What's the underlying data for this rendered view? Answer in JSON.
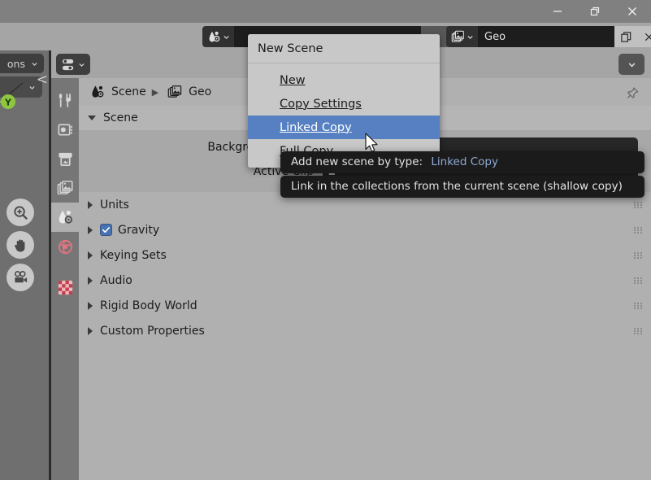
{
  "window": {
    "buttons": [
      {
        "name": "minimize",
        "glyph": "minimize-icon"
      },
      {
        "name": "restore",
        "glyph": "restore-icon"
      },
      {
        "name": "close",
        "glyph": "close-icon"
      }
    ]
  },
  "topbar": {
    "scene_datablock": {
      "icon": "scene-icon",
      "value": "",
      "browse_label": "Browse Scene"
    },
    "viewlayer_datablock": {
      "icon": "view-layer-icon",
      "value": "Geo",
      "copy_label": "New View Layer",
      "remove_label": "Remove View Layer"
    }
  },
  "viewport": {
    "overlay_dropdown_label": "ons",
    "gizmo_axis_label": "Y",
    "nav_buttons": [
      "zoom-region-icon",
      "pan-view-icon",
      "camera-view-icon"
    ],
    "collapse_label": "<"
  },
  "properties": {
    "editor_type": "properties-editor-icon",
    "header_dropdown": "chevron-down-icon",
    "pin_label": "pin-icon",
    "tabs": [
      {
        "name": "tool",
        "icon": "tool-icon",
        "active": false
      },
      {
        "name": "render",
        "icon": "render-icon",
        "active": false
      },
      {
        "name": "output",
        "icon": "output-icon",
        "active": false
      },
      {
        "name": "view-layer",
        "icon": "view-layer-icon",
        "active": false
      },
      {
        "name": "scene",
        "icon": "scene-icon",
        "active": true
      },
      {
        "name": "world",
        "icon": "world-icon",
        "active": false
      },
      {
        "name": "texture",
        "icon": "texture-icon",
        "active": false
      }
    ],
    "breadcrumb": [
      {
        "icon": "scene-icon",
        "label": "Scene"
      },
      {
        "icon": "view-layer-icon",
        "label": "Geo"
      }
    ],
    "scene_panel": {
      "title": "Scene",
      "expanded": true,
      "rows": [
        {
          "label": "Background Scene",
          "value": "",
          "icon": ""
        },
        {
          "label": "Active Clip",
          "value": "",
          "icon": "clapperboard-icon"
        }
      ]
    },
    "collapsed_panels": [
      {
        "label": "Units",
        "checkbox": null
      },
      {
        "label": "Gravity",
        "checkbox": true
      },
      {
        "label": "Keying Sets",
        "checkbox": null
      },
      {
        "label": "Audio",
        "checkbox": null
      },
      {
        "label": "Rigid Body World",
        "checkbox": null
      },
      {
        "label": "Custom Properties",
        "checkbox": null
      }
    ]
  },
  "menu": {
    "title": "New Scene",
    "items": [
      {
        "label": "New",
        "mnemonic": "N",
        "selected": false
      },
      {
        "label": "Copy Settings",
        "mnemonic": "C",
        "selected": false
      },
      {
        "label": "Linked Copy",
        "mnemonic": "L",
        "selected": true
      },
      {
        "label": "Full Copy",
        "mnemonic": "F",
        "selected": false
      }
    ]
  },
  "tooltip": {
    "line1_prefix": "Add new scene by type:",
    "line1_value": "Linked Copy",
    "line2": "Link in the collections from the current scene (shallow copy)"
  },
  "colors": {
    "accent_select": "#5680c2",
    "panel_bg": "#b0b0b0",
    "header_bg": "#a5a5a5",
    "field_bg": "#272727",
    "tooltip_bg": "#1b1b1b",
    "tooltip_accent": "#8ea9d6",
    "checkbox_on": "#4772b3",
    "gizmo_y": "#8ec641",
    "gizmo_x": "#e2495a"
  }
}
